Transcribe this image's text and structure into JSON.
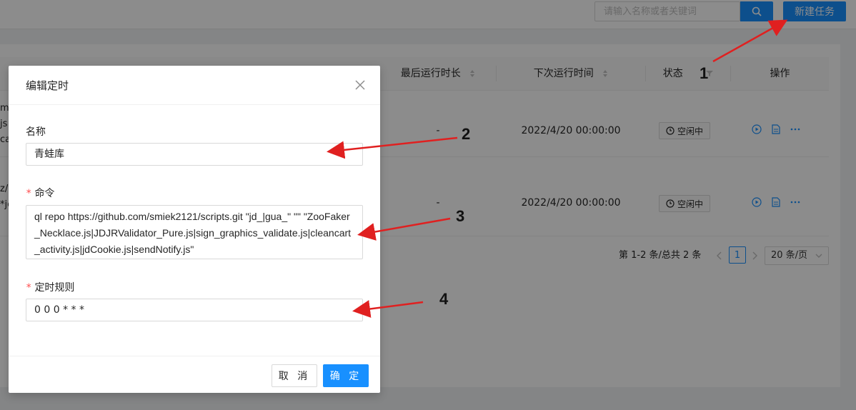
{
  "header": {
    "search_placeholder": "请输入名称或者关键词",
    "new_task_label": "新建任务"
  },
  "table": {
    "columns": [
      "最后运行时长",
      "下次运行时间",
      "状态",
      "操作"
    ],
    "rows": [
      {
        "left_fragment": [
          "mi",
          "js|",
          "car"
        ],
        "last_run_duration": "-",
        "next_run_time": "2022/4/20 00:00:00",
        "status": "空闲中"
      },
      {
        "left_fragment": [
          "z/l",
          "*jc"
        ],
        "last_run_duration": "-",
        "next_run_time": "2022/4/20 00:00:00",
        "status": "空闲中"
      }
    ],
    "pagination": {
      "summary": "第 1-2 条/总共 2 条",
      "current_page": "1",
      "page_size": "20 条/页"
    }
  },
  "modal": {
    "title": "编辑定时",
    "name_label": "名称",
    "name_value": "青蛙库",
    "command_label": "命令",
    "command_value": "ql repo https://github.com/smiek2121/scripts.git \"jd_|gua_\" \"\" \"ZooFaker_Necklace.js|JDJRValidator_Pure.js|sign_graphics_validate.js|cleancart_activity.js|jdCookie.js|sendNotify.js\"",
    "schedule_label": "定时规则",
    "schedule_value": "0 0 0 * * *",
    "required_mark": "*",
    "cancel_label": "取 消",
    "ok_label": "确 定"
  },
  "annotations": {
    "numbers": [
      "1",
      "2",
      "3",
      "4"
    ],
    "arrow_color": "#e02020"
  },
  "colors": {
    "primary": "#1890ff",
    "required": "#ff4d4f"
  }
}
